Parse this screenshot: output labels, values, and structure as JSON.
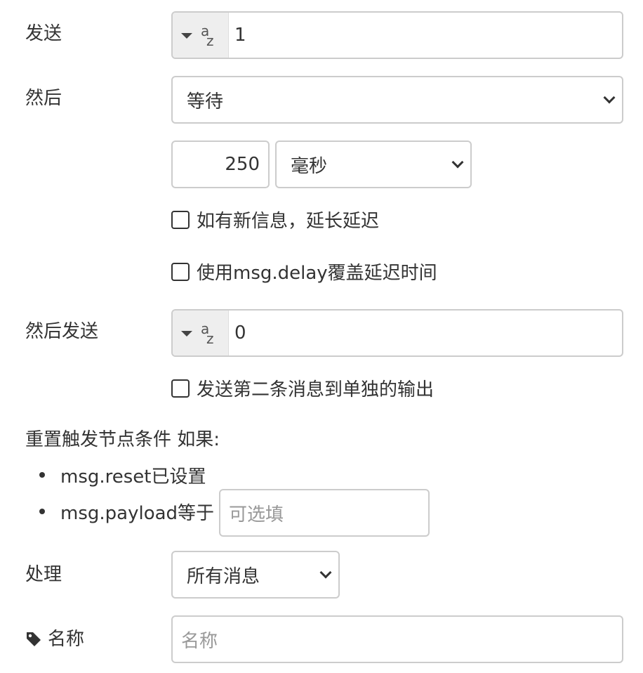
{
  "send": {
    "label": "发送",
    "value": "1",
    "type_icon": "az-string-icon"
  },
  "then": {
    "label": "然后",
    "selected": "等待"
  },
  "delay": {
    "value": "250",
    "unit": "毫秒"
  },
  "extend_checkbox": {
    "label": "如有新信息，延长延迟",
    "checked": false
  },
  "override_checkbox": {
    "label": "使用msg.delay覆盖延迟时间",
    "checked": false
  },
  "then_send": {
    "label": "然后发送",
    "value": "0",
    "type_icon": "az-string-icon"
  },
  "second_output_checkbox": {
    "label": "发送第二条消息到单独的输出",
    "checked": false
  },
  "reset": {
    "heading": "重置触发节点条件 如果:",
    "item1": "msg.reset已设置",
    "item2": "msg.payload等于",
    "payload_placeholder": "可选填"
  },
  "handle": {
    "label": "处理",
    "selected": "所有消息"
  },
  "name": {
    "label": "名称",
    "placeholder": "名称",
    "icon": "tag-icon"
  }
}
